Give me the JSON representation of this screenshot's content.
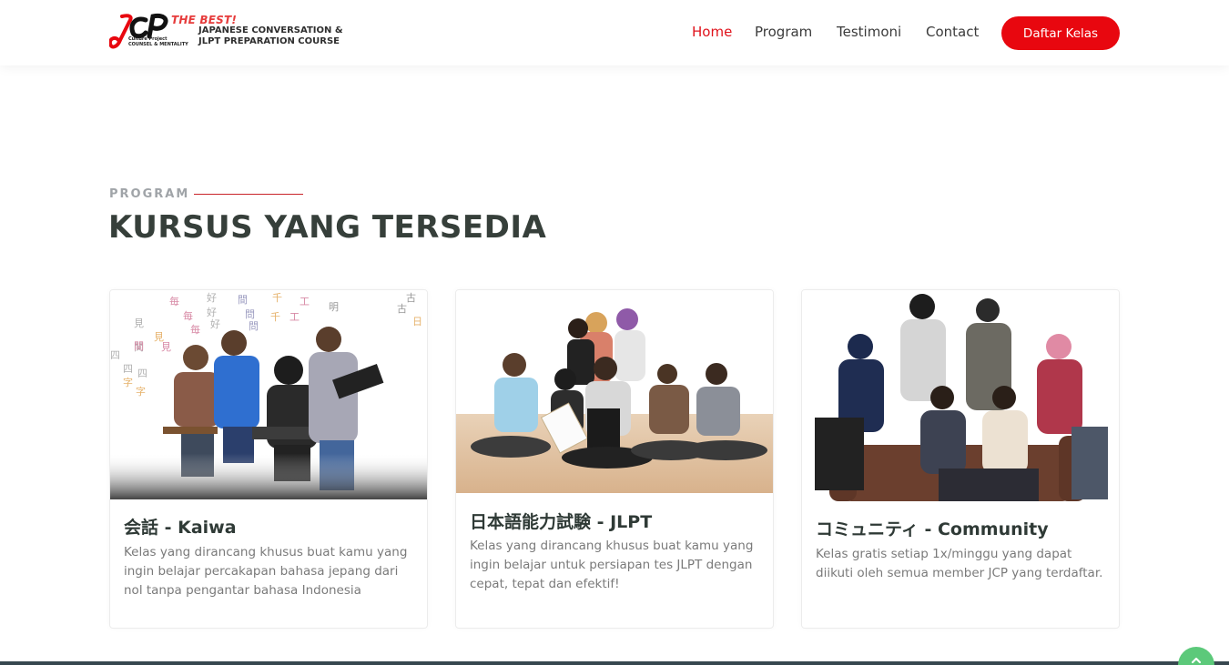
{
  "brand": {
    "tagline": "THE BEST!",
    "line1": "JAPANESE CONVERSATION &",
    "line2": "JLPT PREPARATION COURSE",
    "small_text": [
      "Culture Project",
      "COUNSEL & MENTALITY"
    ],
    "accent_color": "#e8070f"
  },
  "nav": {
    "items": [
      {
        "label": "Home",
        "active": true
      },
      {
        "label": "Program",
        "active": false
      },
      {
        "label": "Testimoni",
        "active": false
      },
      {
        "label": "Contact",
        "active": false
      }
    ],
    "cta_label": "Daftar Kelas"
  },
  "section": {
    "eyebrow": "PROGRAM",
    "title": "KURSUS YANG TERSEDIA"
  },
  "cards": [
    {
      "title": "会話 - Kaiwa",
      "description": "Kelas yang dirancang khusus buat kamu yang ingin belajar percakapan bahasa jepang dari nol tanpa pengantar bahasa Indonesia",
      "image": "students-reading-with-kanji-background"
    },
    {
      "title": "日本語能力試験 - JLPT",
      "description": "Kelas yang dirancang khusus buat kamu yang ingin belajar untuk persiapan tes JLPT dengan cepat, tepat dan efektif!",
      "image": "group-sitting-on-floor"
    },
    {
      "title": "コミュニティ - Community",
      "description": "Kelas gratis setiap 1x/minggu yang dapat diikuti oleh semua member JCP yang terdaftar.",
      "image": "group-posing-on-sofa"
    }
  ],
  "colors": {
    "nav_active": "#e0131c",
    "heading": "#363f3a",
    "eyebrow": "#a0a4a8",
    "scroll_top": "#5cc97a"
  },
  "icons": {
    "scroll_top": "chevron-up-icon"
  }
}
